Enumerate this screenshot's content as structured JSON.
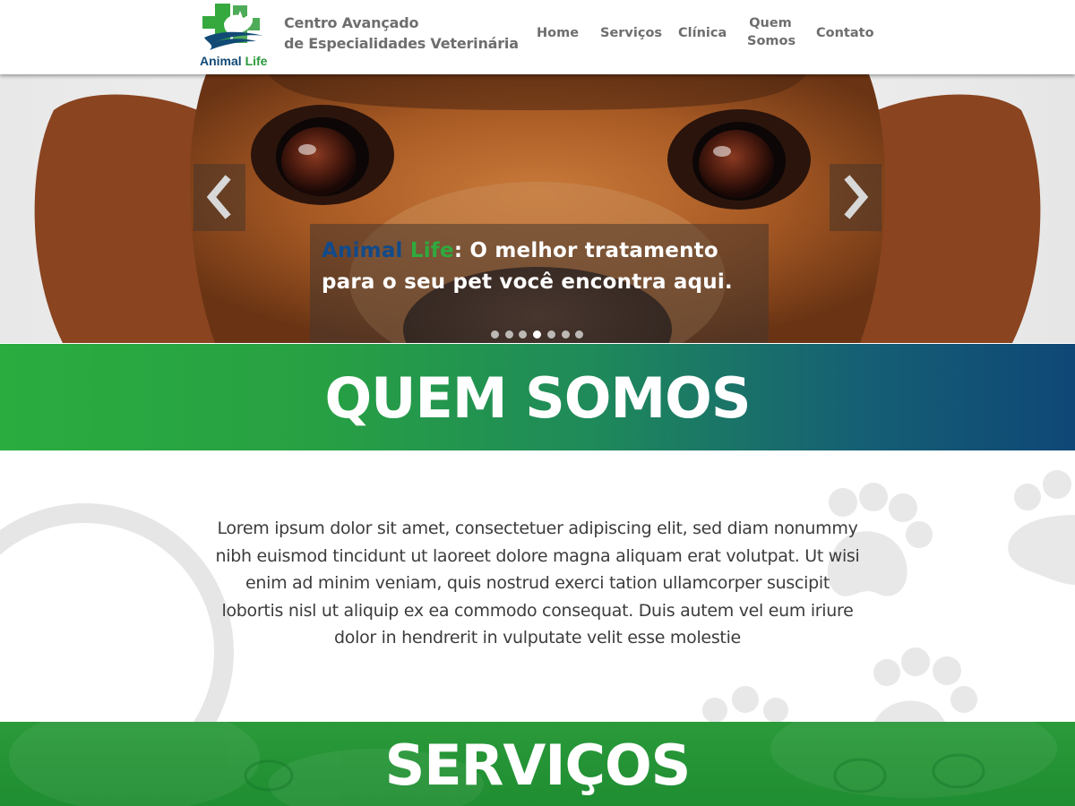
{
  "header": {
    "logo": {
      "word1": "Animal",
      "word2": "Life",
      "icon": "animal-life-cross-logo-icon"
    },
    "tagline": {
      "line1": "Centro Avançado",
      "line2": "de Especialidades Veterinária"
    },
    "nav": {
      "home": "Home",
      "servicos": "Serviços",
      "clinica": "Clínica",
      "quem_somos": "Quem Somos",
      "contato": "Contato"
    }
  },
  "hero": {
    "caption": {
      "brand1": "Animal",
      "brand2": "Life",
      "rest": ": O melhor tratamento para o seu pet você encontra aqui."
    },
    "prev_icon": "chevron-left-icon",
    "next_icon": "chevron-right-icon",
    "slide_count": 7,
    "active_slide": 4
  },
  "quem_somos": {
    "title": "QUEM SOMOS",
    "body": "Lorem ipsum dolor sit amet, consectetuer adipiscing elit, sed diam nonummy nibh euismod tincidunt ut laoreet dolore magna aliquam erat volutpat. Ut wisi enim ad minim veniam, quis nostrud exerci tation ullamcorper suscipit lobortis nisl ut aliquip ex ea commodo consequat. Duis autem vel eum iriure dolor in hendrerit in vulputate velit esse molestie"
  },
  "servicos": {
    "title": "SERVIÇOS"
  },
  "colors": {
    "brand_green": "#2aac3f",
    "brand_blue": "#0f4776",
    "nav_text": "#6e6e6e",
    "body_text": "#3c3c3c"
  }
}
